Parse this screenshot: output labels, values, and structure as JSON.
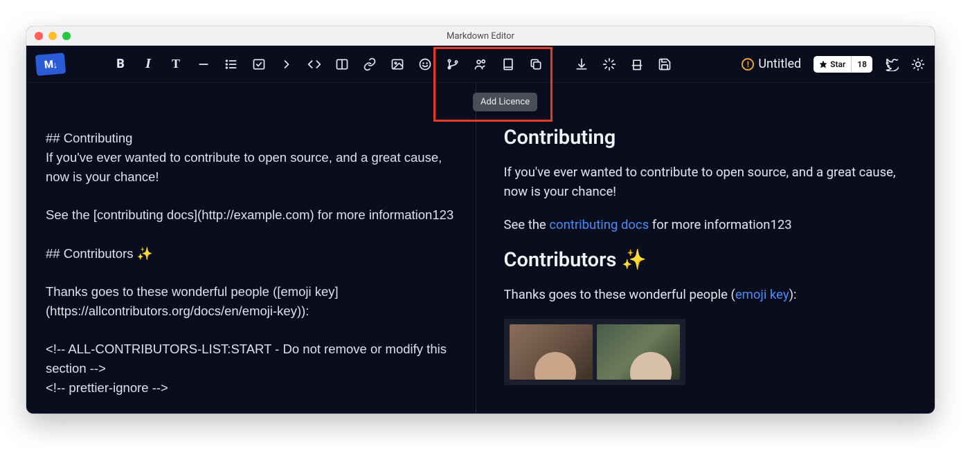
{
  "window": {
    "title": "Markdown Editor"
  },
  "logo": {
    "text": "M",
    "arrow": "↓"
  },
  "file": {
    "status_icon": "!",
    "name": "Untitled"
  },
  "star": {
    "label": "Star",
    "count": "18"
  },
  "tooltip": "Add Licence",
  "toolbar_icons": {
    "bold": "B",
    "italic": "I",
    "heading": "T"
  },
  "editor": {
    "raw": "## Contributing\nIf you've ever wanted to contribute to open source, and a great cause, now is your chance!\n\nSee the [contributing docs](http://example.com) for more information123\n\n## Contributors ✨\n\nThanks goes to these wonderful people ([emoji key](https://allcontributors.org/docs/en/emoji-key)):\n\n<!-- ALL-CONTRIBUTORS-LIST:START - Do not remove or modify this section -->\n<!-- prettier-ignore -->"
  },
  "preview": {
    "h_contributing": "Contributing",
    "p_intro": "If you've ever wanted to contribute to open source, and a great cause, now is your chance!",
    "p_see_pre": "See the ",
    "link_docs": "contributing docs",
    "p_see_post": " for more information123",
    "h_contributors": "Contributors ✨",
    "p_thanks_pre": "Thanks goes to these wonderful people (",
    "link_emoji": "emoji key",
    "p_thanks_post": "):"
  }
}
